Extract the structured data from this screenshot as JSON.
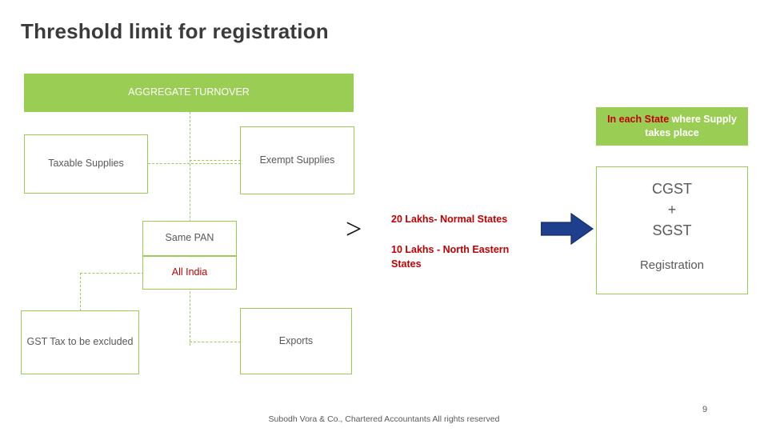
{
  "slide": {
    "title": "Threshold limit for registration",
    "page_number": "9",
    "footer": "Subodh Vora & Co., Chartered Accountants  All rights reserved"
  },
  "colors": {
    "green": "#9ACD53",
    "red": "#C00000",
    "blue_arrow": "#1F3E8C",
    "text_gray": "#595959"
  },
  "diagram": {
    "aggregate_turnover": "AGGREGATE TURNOVER",
    "taxable_supplies": "Taxable Supplies",
    "exempt_supplies": "Exempt Supplies",
    "same_pan": "Same PAN",
    "all_india": "All India",
    "gst_excluded": "GST Tax to be excluded",
    "exports": "Exports",
    "comparison_symbol": ">",
    "threshold_normal": "20 Lakhs- Normal States",
    "threshold_north_eastern": "10 Lakhs - North Eastern States"
  },
  "right_panel": {
    "in_each_state_strong": "In each State",
    "in_each_state_rest": " where Supply takes place",
    "tax_line1": "CGST",
    "tax_line2": "+",
    "tax_line3": "SGST",
    "registration": "Registration"
  },
  "icons": {
    "arrow": "right-arrow-icon"
  }
}
